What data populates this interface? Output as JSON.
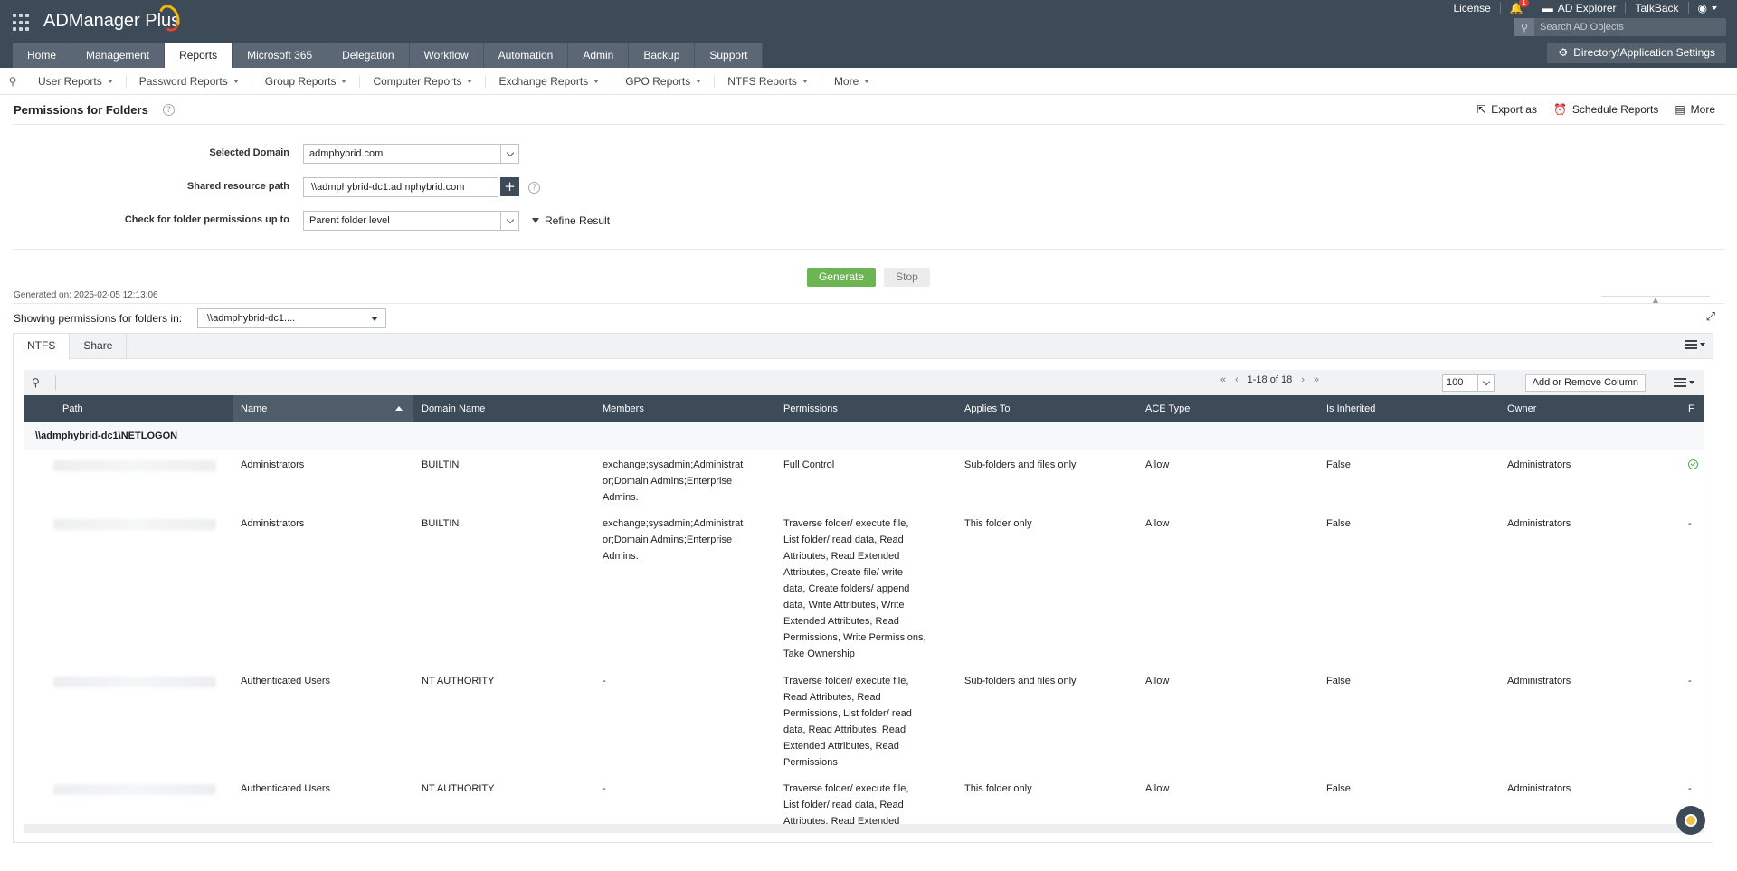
{
  "header": {
    "app_name": "ADManager Plus",
    "links": [
      "License",
      "AD Explorer",
      "TalkBack"
    ],
    "notification_count": "1",
    "search_placeholder": "Search AD Objects",
    "settings_label": "Directory/Application Settings"
  },
  "main_tabs": [
    "Home",
    "Management",
    "Reports",
    "Microsoft 365",
    "Delegation",
    "Workflow",
    "Automation",
    "Admin",
    "Backup",
    "Support"
  ],
  "active_main_tab": "Reports",
  "sub_nav": [
    "User Reports",
    "Password Reports",
    "Group Reports",
    "Computer Reports",
    "Exchange Reports",
    "GPO Reports",
    "NTFS Reports",
    "More"
  ],
  "page": {
    "title": "Permissions for Folders",
    "actions": [
      "Export as",
      "Schedule Reports",
      "More"
    ]
  },
  "form": {
    "domain_label": "Selected Domain",
    "domain_value": "admphybrid.com",
    "path_label": "Shared resource path",
    "path_value": "\\\\admphybrid-dc1.admphybrid.com",
    "level_label": "Check for folder permissions up to",
    "level_value": "Parent folder level",
    "refine_label": "Refine Result",
    "generate_label": "Generate",
    "stop_label": "Stop"
  },
  "result": {
    "generated_on": "Generated on: 2025-02-05 12:13:06",
    "showing_label": "Showing permissions for folders in:",
    "folder_value": "\\\\admphybrid-dc1....",
    "tabs": [
      "NTFS",
      "Share"
    ],
    "active_tab": "NTFS",
    "pager_text": "1-18 of 18",
    "per_page": "100",
    "add_remove_label": "Add or Remove Column"
  },
  "grid": {
    "columns": [
      "Path",
      "Name",
      "Domain Name",
      "Members",
      "Permissions",
      "Applies To",
      "ACE Type",
      "Is Inherited",
      "Owner",
      "F"
    ],
    "sorted_column": "Name",
    "group": "\\\\admphybrid-dc1\\NETLOGON",
    "rows": [
      {
        "name": "Administrators",
        "domain": "BUILTIN",
        "members": [
          "exchange;sysadmin;Administrat",
          "or;Domain Admins;Enterprise",
          "Admins."
        ],
        "permissions": [
          "Full Control"
        ],
        "applies_to": "Sub-folders and files only",
        "ace_type": "Allow",
        "inherited": "False",
        "owner": "Administrators",
        "f": "check"
      },
      {
        "name": "Administrators",
        "domain": "BUILTIN",
        "members": [
          "exchange;sysadmin;Administrat",
          "or;Domain Admins;Enterprise",
          "Admins."
        ],
        "permissions": [
          "Traverse folder/ execute file,",
          "List folder/ read data, Read",
          "Attributes, Read Extended",
          "Attributes, Create file/ write",
          "data, Create folders/ append",
          "data, Write Attributes, Write",
          "Extended Attributes, Read",
          "Permissions, Write Permissions,",
          "Take Ownership"
        ],
        "applies_to": "This folder only",
        "ace_type": "Allow",
        "inherited": "False",
        "owner": "Administrators",
        "f": "-"
      },
      {
        "name": "Authenticated Users",
        "domain": "NT AUTHORITY",
        "members": [
          "-"
        ],
        "permissions": [
          "Traverse folder/ execute file,",
          "Read Attributes, Read",
          "Permissions, List folder/ read",
          "data, Read Attributes, Read",
          "Extended Attributes, Read",
          "Permissions"
        ],
        "applies_to": "Sub-folders and files only",
        "ace_type": "Allow",
        "inherited": "False",
        "owner": "Administrators",
        "f": "-"
      },
      {
        "name": "Authenticated Users",
        "domain": "NT AUTHORITY",
        "members": [
          "-"
        ],
        "permissions": [
          "Traverse folder/ execute file,",
          "List folder/ read data, Read",
          "Attributes, Read Extended"
        ],
        "applies_to": "This folder only",
        "ace_type": "Allow",
        "inherited": "False",
        "owner": "Administrators",
        "f": "-"
      }
    ]
  }
}
